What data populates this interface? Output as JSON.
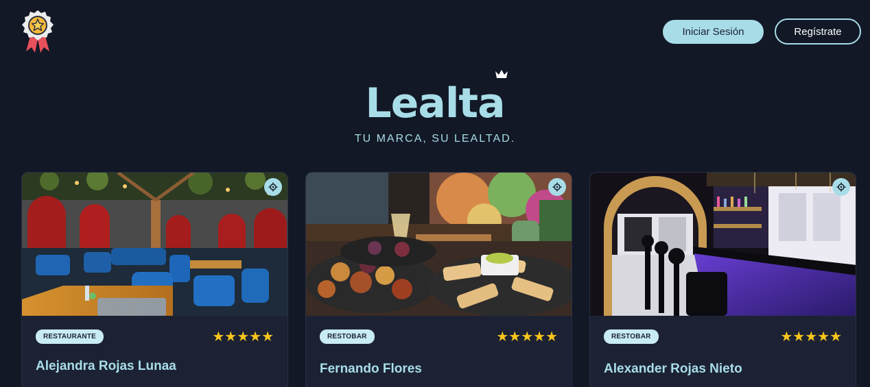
{
  "header": {
    "login_label": "Iniciar Sesión",
    "register_label": "Regístrate"
  },
  "hero": {
    "brand": "Lealta",
    "tagline": "TU MARCA, SU LEALTAD."
  },
  "cards": [
    {
      "category": "RESTAURANTE",
      "name": "Alejandra Rojas Lunaa",
      "rating": 5,
      "stars": "★★★★★"
    },
    {
      "category": "RESTOBAR",
      "name": "Fernando Flores",
      "rating": 5,
      "stars": "★★★★★"
    },
    {
      "category": "RESTOBAR",
      "name": "Alexander Rojas Nieto",
      "rating": 5,
      "stars": "★★★★★"
    }
  ],
  "colors": {
    "background": "#121826",
    "accent": "#a8dde8",
    "card": "#1c2234",
    "star": "#f8c51c"
  }
}
